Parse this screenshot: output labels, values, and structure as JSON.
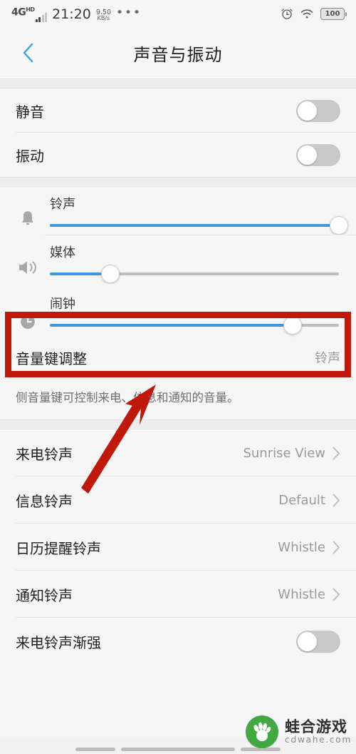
{
  "statusbar": {
    "network_type": "4G",
    "network_sup": "HD",
    "time": "21:20",
    "netspeed_value": "9.50",
    "netspeed_unit": "KB/s",
    "overflow_dots": "•••",
    "alarm_icon": "alarm-clock-icon",
    "wifi_icon": "wifi-icon",
    "battery_level": "100"
  },
  "header": {
    "back_icon": "chevron-left-icon",
    "title": "声音与振动",
    "accent_color": "#4aa8e0"
  },
  "toggles": [
    {
      "label": "静音",
      "state": "off"
    },
    {
      "label": "振动",
      "state": "off"
    }
  ],
  "sliders": [
    {
      "icon": "bell-icon",
      "label": "铃声",
      "value": 100
    },
    {
      "icon": "speaker-icon",
      "label": "媒体",
      "value": 21
    },
    {
      "icon": "alarm-clock-icon",
      "label": "闹钟",
      "value": 84
    }
  ],
  "volume_key": {
    "label": "音量键调整",
    "value": "铃声",
    "description": "侧音量键可控制来电、信息和通知的音量。"
  },
  "ringtone_rows": [
    {
      "label": "来电铃声",
      "value": "Sunrise View",
      "chevron": "chevron-right-icon"
    },
    {
      "label": "信息铃声",
      "value": "Default",
      "chevron": "chevron-right-icon"
    },
    {
      "label": "日历提醒铃声",
      "value": "Whistle",
      "chevron": "chevron-right-icon"
    },
    {
      "label": "通知铃声",
      "value": "Whistle",
      "chevron": "chevron-right-icon"
    }
  ],
  "bottom_toggle": {
    "label": "来电铃声渐强",
    "state": "off"
  },
  "annotation": {
    "highlight_color": "#c0190c",
    "arrow_color": "#c0190c",
    "target": "闹钟"
  },
  "watermark": {
    "name": "蛙合游戏",
    "url": "cdwahe.com",
    "logo_color": "#41a93f",
    "logo_icon": "frog-foot-logo-icon"
  },
  "slider_colors": {
    "fill": "#3f96e0",
    "track": "#bdbdbd"
  }
}
